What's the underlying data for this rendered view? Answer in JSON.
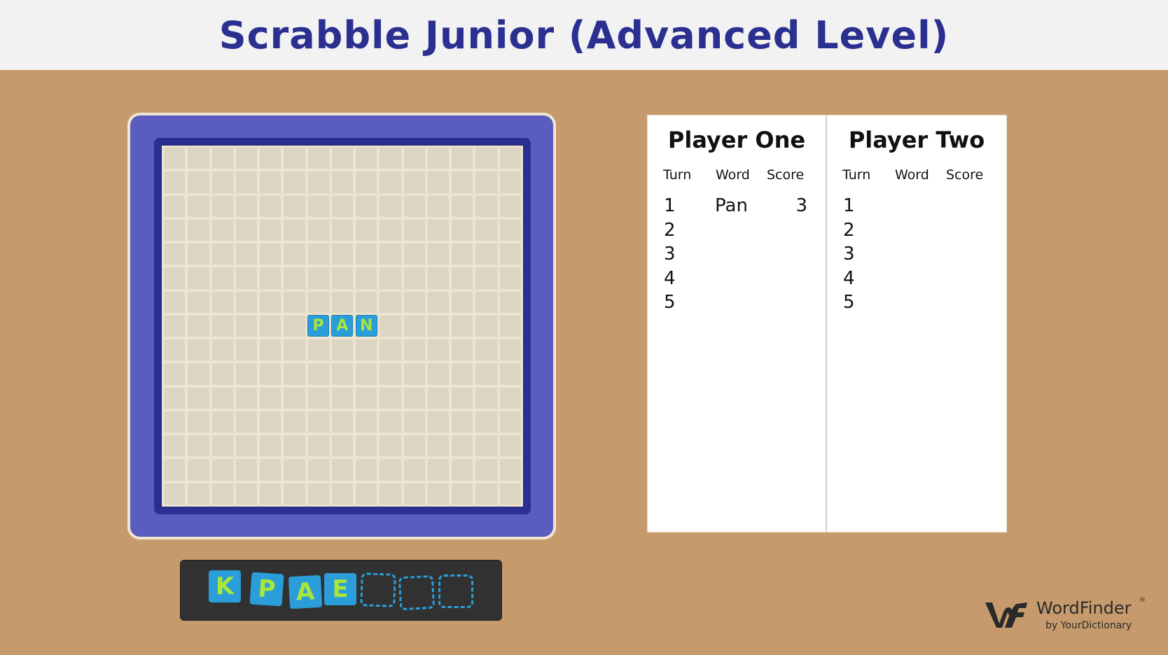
{
  "header": {
    "title": "Scrabble Junior (Advanced Level)"
  },
  "board": {
    "rows": 15,
    "cols": 15,
    "placed_tiles": [
      {
        "letter": "P",
        "row": 7,
        "col": 6
      },
      {
        "letter": "A",
        "row": 7,
        "col": 7
      },
      {
        "letter": "N",
        "row": 7,
        "col": 8
      }
    ]
  },
  "rack": {
    "tiles": [
      "K",
      "P",
      "A",
      "E"
    ],
    "empty_slots": 3
  },
  "scoresheet": {
    "columns": [
      "Turn",
      "Word",
      "Score"
    ],
    "players": [
      {
        "name": "Player One",
        "turns": [
          {
            "turn": "1",
            "word": "Pan",
            "score": "3"
          },
          {
            "turn": "2",
            "word": "",
            "score": ""
          },
          {
            "turn": "3",
            "word": "",
            "score": ""
          },
          {
            "turn": "4",
            "word": "",
            "score": ""
          },
          {
            "turn": "5",
            "word": "",
            "score": ""
          }
        ]
      },
      {
        "name": "Player Two",
        "turns": [
          {
            "turn": "1",
            "word": "",
            "score": ""
          },
          {
            "turn": "2",
            "word": "",
            "score": ""
          },
          {
            "turn": "3",
            "word": "",
            "score": ""
          },
          {
            "turn": "4",
            "word": "",
            "score": ""
          },
          {
            "turn": "5",
            "word": "",
            "score": ""
          }
        ]
      }
    ]
  },
  "branding": {
    "logo_icon": "wordfinder-logo-icon",
    "name": "WordFinder",
    "registered_mark": "®",
    "subtitle": "by YourDictionary"
  },
  "colors": {
    "title": "#2b2f8f",
    "board_frame": "#5a5dbf",
    "board_inner": "#2b2e92",
    "tile": "#2b9ed9",
    "tile_letter": "#a8e63a",
    "rack": "#313131",
    "background": "#c69a6c"
  }
}
